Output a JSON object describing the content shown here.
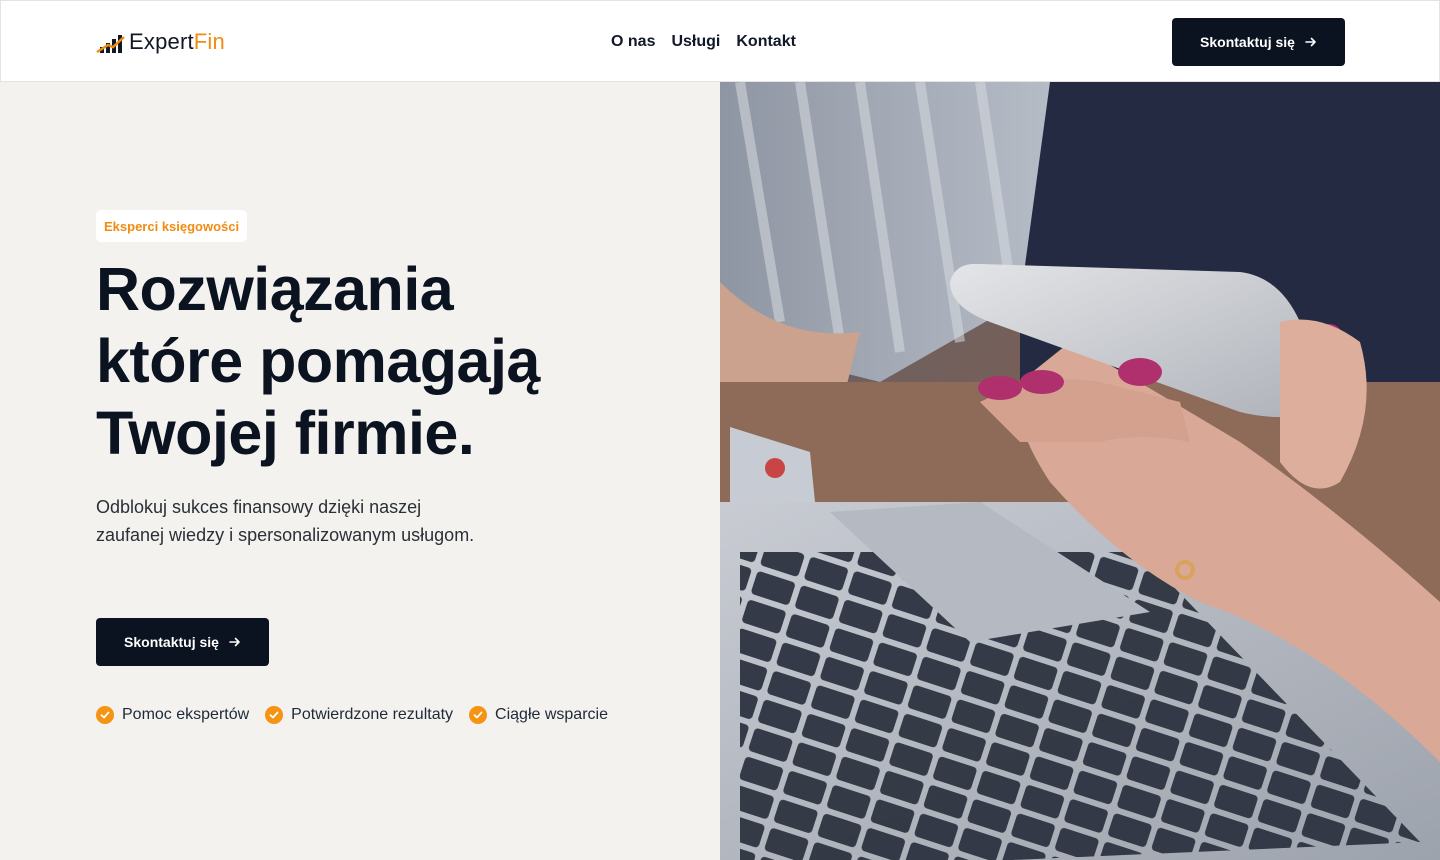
{
  "brand": {
    "name_primary": "Expert",
    "name_accent": "Fin",
    "accent_color": "#f08c12",
    "dark_color": "#0b1220"
  },
  "nav": {
    "items": [
      {
        "label": "O nas"
      },
      {
        "label": "Usługi"
      },
      {
        "label": "Kontakt"
      }
    ]
  },
  "header": {
    "cta_label": "Skontaktuj się",
    "cta_icon": "arrow-right-icon"
  },
  "hero": {
    "badge": "Eksperci księgowości",
    "headline_lines": [
      "Rozwiązania",
      "które pomagają",
      "Twojej firmie."
    ],
    "subtext": "Odblokuj sukces finansowy dzięki naszej zaufanej wiedzy i spersonalizowanym usługom.",
    "cta_label": "Skontaktuj się",
    "image_alt": "hands-with-phone-and-laptop-photo",
    "features": [
      {
        "label": "Pomoc ekspertów",
        "icon": "check-circle-icon"
      },
      {
        "label": "Potwierdzone rezultaty",
        "icon": "check-circle-icon"
      },
      {
        "label": "Ciągłe wsparcie",
        "icon": "check-circle-icon"
      }
    ]
  }
}
